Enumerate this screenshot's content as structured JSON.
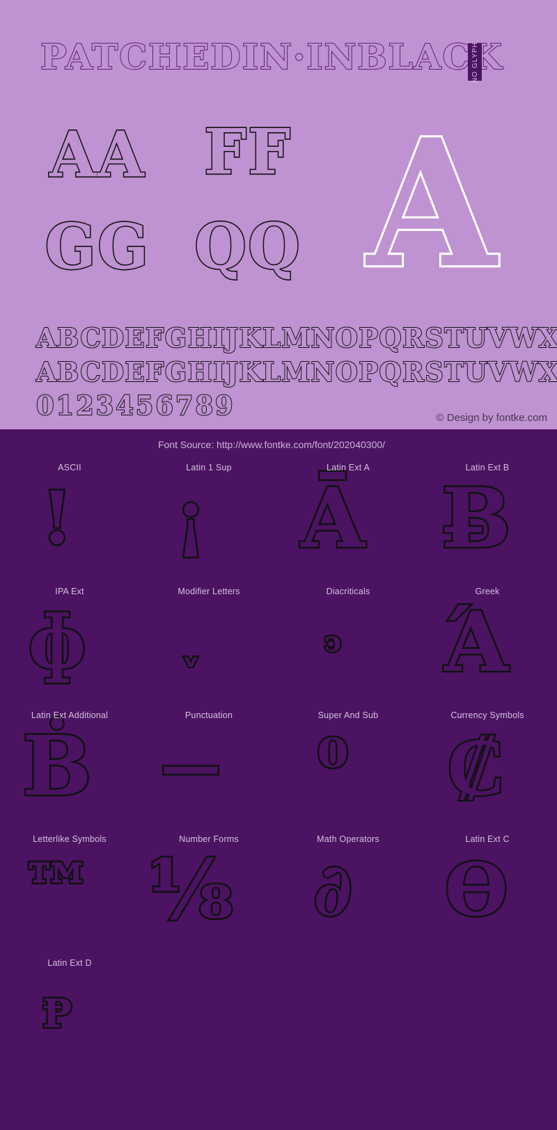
{
  "theme": {
    "top_bg": "#bf92d2",
    "bottom_bg": "#4b1362",
    "title_stroke": "#5d2176",
    "glyph_stroke": "#111111",
    "white_glyph": "#ffffff",
    "label_color": "#d5c2de"
  },
  "header": {
    "title": "PATCHEDIN·INBLACK",
    "badge": "NO GLYPH"
  },
  "samples": [
    {
      "name": "sample-aa",
      "text": "AA",
      "style": "outline"
    },
    {
      "name": "sample-ff",
      "text": "FF",
      "style": "outline"
    },
    {
      "name": "sample-gg",
      "text": "GG",
      "style": "outline"
    },
    {
      "name": "sample-qq",
      "text": "QQ",
      "style": "outline"
    },
    {
      "name": "sample-big-a",
      "text": "A",
      "style": "white-outline"
    }
  ],
  "alphabet": {
    "line1": "ABCDEFGHIJKLMNOPQRSTUVWXYZ",
    "line2": "ABCDEFGHIJKLMNOPQRSTUVWXYZ",
    "line3": "0123456789"
  },
  "copyright": "© Design by fontke.com",
  "font_source": "Font Source: http://www.fontke.com/font/202040300/",
  "categories": [
    {
      "label": "ASCII",
      "glyph": "!",
      "size": "sz-lg"
    },
    {
      "label": "Latin 1 Sup",
      "glyph": "¡",
      "size": "sz-lg"
    },
    {
      "label": "Latin Ext A",
      "glyph": "Ā",
      "size": "sz-xl"
    },
    {
      "label": "Latin Ext B",
      "glyph": "Ƀ",
      "size": "sz-xl"
    },
    {
      "label": "IPA Ext",
      "glyph": "ɸ",
      "size": "sz-lg"
    },
    {
      "label": "Modifier Letters",
      "glyph": "ˬ",
      "size": "sz-sm"
    },
    {
      "label": "Diacriticals",
      "glyph": "ͽ",
      "size": "sz-xs"
    },
    {
      "label": "Greek",
      "glyph": "Ά",
      "size": "sz-xl"
    },
    {
      "label": "Latin Ext Additional",
      "glyph": "Ḃ",
      "size": "sz-xl"
    },
    {
      "label": "Punctuation",
      "glyph": "—",
      "size": "sz-md"
    },
    {
      "label": "Super And Sub",
      "glyph": "⁰",
      "size": "sz-lg"
    },
    {
      "label": "Currency Symbols",
      "glyph": "₡",
      "size": "sz-xl"
    },
    {
      "label": "Letterlike Symbols",
      "glyph": "™",
      "size": "sz-lg"
    },
    {
      "label": "Number Forms",
      "glyph": "⅛",
      "size": "sz-xl"
    },
    {
      "label": "Math Operators",
      "glyph": "∂",
      "size": "sz-lg"
    },
    {
      "label": "Latin Ext C",
      "glyph": "Ɵ",
      "size": "sz-lg"
    },
    {
      "label": "Latin Ext D",
      "glyph": "Ᵽ",
      "size": "sz-sm"
    }
  ]
}
